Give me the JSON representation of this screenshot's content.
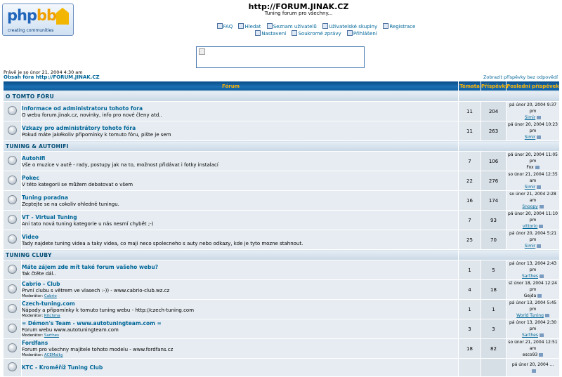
{
  "logo": {
    "text_main": "php",
    "text_accent": "bb",
    "tagline": "creating communities"
  },
  "site": {
    "title": "http://FORUM.JINAK.CZ",
    "description": "Tuning forum pro všechny..."
  },
  "nav": {
    "row1": [
      {
        "label": "FAQ",
        "icon": "faq-icon"
      },
      {
        "label": "Hledat",
        "icon": "search-icon"
      },
      {
        "label": "Seznam uživatelů",
        "icon": "memberlist-icon"
      },
      {
        "label": "Uživatelské skupiny",
        "icon": "usergroups-icon"
      },
      {
        "label": "Registrace",
        "icon": "register-icon"
      }
    ],
    "row2": [
      {
        "label": "Nastavení",
        "icon": "profile-icon"
      },
      {
        "label": "Soukromé zprávy",
        "icon": "private-messages-icon"
      },
      {
        "label": "Přihlášení",
        "icon": "login-icon"
      }
    ]
  },
  "datetime": "Právě je so únor 21, 2004 4:30 am",
  "forum_index_link": "Obsah fóra http://FORUM.JINAK.CZ",
  "unanswered_link": "Zobrazit příspěvky bez odpovědí",
  "table": {
    "headers": {
      "forum": "Fórum",
      "topics": "Témata",
      "posts": "Příspěvky",
      "last": "Poslední příspěvek"
    }
  },
  "categories": [
    {
      "name": "O TOMTO FÓRU",
      "forums": [
        {
          "title": "Informace od administratoru tohoto fora",
          "desc": "O webu forum.jinak.cz, novinky, info pro nové členy atd..",
          "topics": "11",
          "posts": "204",
          "last_date": "pá únor 20, 2004 9:37 pm",
          "last_user": "Simir",
          "user_link": true
        },
        {
          "title": "Vzkazy pro administrátory tohoto fóra",
          "desc": "Pokud máte jakékoliv připomínky k tomuto fóru, pište je sem",
          "topics": "11",
          "posts": "263",
          "last_date": "pá únor 20, 2004 10:23 pm",
          "last_user": "Simir",
          "user_link": true
        }
      ]
    },
    {
      "name": "TUNING & AUTOHIFI",
      "forums": [
        {
          "title": "Autohifi",
          "desc": "Vše o muzice v autě - rady, postupy jak na to, možnost přidávat i fotky instalací",
          "topics": "7",
          "posts": "106",
          "last_date": "pá únor 20, 2004 11:05 pm",
          "last_user": "Fox",
          "user_link": false
        },
        {
          "title": "Pokec",
          "desc": "V této kategorii se můžem debatovat o všem",
          "topics": "22",
          "posts": "276",
          "last_date": "so únor 21, 2004 12:35 am",
          "last_user": "Simir",
          "user_link": true
        },
        {
          "title": "Tuning poradna",
          "desc": "Zeptejte se na cokoliv ohledně tuningu.",
          "topics": "16",
          "posts": "174",
          "last_date": "so únor 21, 2004 2:28 am",
          "last_user": "Snoopy",
          "user_link": true
        },
        {
          "title": "VT - Virtual Tuning",
          "desc": "Ani tato nová tuning kategorie u nás nesmí chybět ;-)",
          "topics": "7",
          "posts": "93",
          "last_date": "pá únor 20, 2004 11:10 pm",
          "last_user": "vittorio",
          "user_link": true
        },
        {
          "title": "Video",
          "desc": "Tady najdete tuning videa a taky videa, co maji neco spolecneho s auty nebo odkazy, kde je tyto mozne stahnout.",
          "topics": "25",
          "posts": "70",
          "last_date": "pá únor 20, 2004 5:21 pm",
          "last_user": "Simir",
          "user_link": true
        }
      ]
    },
    {
      "name": "TUNING CLUBY",
      "forums": [
        {
          "title": "Máte zájem zde mít také forum vašeho webu?",
          "desc": "Tak čtěte dál..",
          "topics": "1",
          "posts": "5",
          "last_date": "pá únor 13, 2004 2:43 pm",
          "last_user": "Sarthes",
          "user_link": true
        },
        {
          "title": "Cabrio - Club",
          "desc": "První clubu s větrem ve vlasech :-)) - www.cabrio-club.wz.cz",
          "mod_label": "Moderátor",
          "mod": "Cabrio",
          "topics": "4",
          "posts": "18",
          "last_date": "st únor 18, 2004 12:24 pm",
          "last_user": "Gejda",
          "user_link": false
        },
        {
          "title": "Czech-tuning.com",
          "desc": "Nápady a připomínky k tomuto tuning webu - http://czech-tuning.com",
          "mod_label": "Moderátor",
          "mod": "Ritchma",
          "topics": "1",
          "posts": "1",
          "last_date": "pá únor 13, 2004 5:45 pm",
          "last_user": "World Tuning",
          "user_link": true
        },
        {
          "title": "= Démon's Team - www.autotuningteam.com =",
          "desc": "Forum webu www.autotuningteam.com",
          "mod_label": "Moderátor",
          "mod": "Sarthes",
          "topics": "3",
          "posts": "3",
          "last_date": "pá únor 13, 2004 2:30 pm",
          "last_user": "Sarthes",
          "user_link": true
        },
        {
          "title": "Fordfans",
          "desc": "Forum pro všechny majitele tohoto modelu - www.fordfans.cz",
          "mod_label": "Moderátor",
          "mod": "ACEMalky",
          "topics": "18",
          "posts": "82",
          "last_date": "so únor 21, 2004 12:51 am",
          "last_user": "esco93",
          "user_link": false
        },
        {
          "title": "KTC - Kroměříž Tuning Club",
          "desc": "",
          "topics": "",
          "posts": "",
          "last_date": "pá únor 20, 2004 ...",
          "last_user": "",
          "user_link": false
        }
      ]
    }
  ]
}
